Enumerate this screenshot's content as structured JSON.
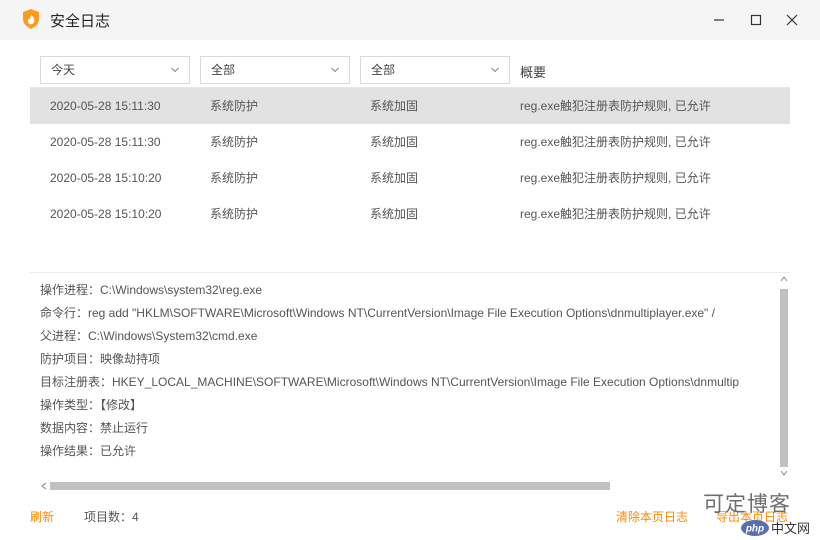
{
  "window": {
    "title": "安全日志",
    "icon": "flame-shield-icon",
    "accent": "#ff8a00"
  },
  "filters": {
    "date": "今天",
    "type": "全部",
    "subtype": "全部",
    "summary_header": "概要"
  },
  "rows": [
    {
      "time": "2020-05-28 15:11:30",
      "type": "系统防护",
      "sub": "系统加固",
      "summary": "reg.exe触犯注册表防护规则, 已允许"
    },
    {
      "time": "2020-05-28 15:11:30",
      "type": "系统防护",
      "sub": "系统加固",
      "summary": "reg.exe触犯注册表防护规则, 已允许"
    },
    {
      "time": "2020-05-28 15:10:20",
      "type": "系统防护",
      "sub": "系统加固",
      "summary": "reg.exe触犯注册表防护规则, 已允许"
    },
    {
      "time": "2020-05-28 15:10:20",
      "type": "系统防护",
      "sub": "系统加固",
      "summary": "reg.exe触犯注册表防护规则, 已允许"
    }
  ],
  "selected_row": 0,
  "detail": {
    "lines": [
      "操作进程：C:\\Windows\\system32\\reg.exe",
      "命令行：reg  add \"HKLM\\SOFTWARE\\Microsoft\\Windows NT\\CurrentVersion\\Image File Execution Options\\dnmultiplayer.exe\" /",
      "父进程：C:\\Windows\\System32\\cmd.exe",
      "防护项目：映像劫持项",
      "目标注册表：HKEY_LOCAL_MACHINE\\SOFTWARE\\Microsoft\\Windows NT\\CurrentVersion\\Image File Execution Options\\dnmultip",
      "操作类型：【修改】",
      "数据内容：禁止运行",
      "操作结果：已允许"
    ]
  },
  "footer": {
    "refresh": "刷新",
    "count": "项目数：4",
    "clear": "清除本页日志",
    "export": "导出本页日志"
  },
  "watermark": {
    "text": "可定博客",
    "logo": "php中文网"
  }
}
